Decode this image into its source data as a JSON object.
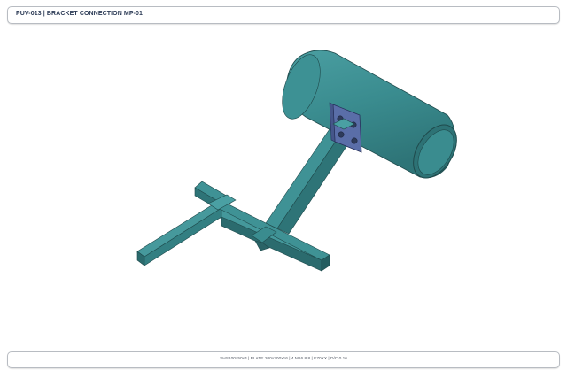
{
  "header": {
    "title": "PUV-013 | BRACKET CONNECTION MP-01"
  },
  "footer": {
    "specs": "SHS100x50x4  |  PLATE 200x200x16  |  4 M16 8.8  |  E70XX  |  D/C 0.16"
  },
  "colors": {
    "steel": "#3a8c8f",
    "steel_dark": "#2c6d70",
    "steel_light": "#4ea3a6",
    "plate": "#5a6ea8",
    "bolt": "#2e3b5a",
    "title_text": "#2b3a55"
  },
  "icons": {
    "model": "steel-bracket-3d-model"
  }
}
